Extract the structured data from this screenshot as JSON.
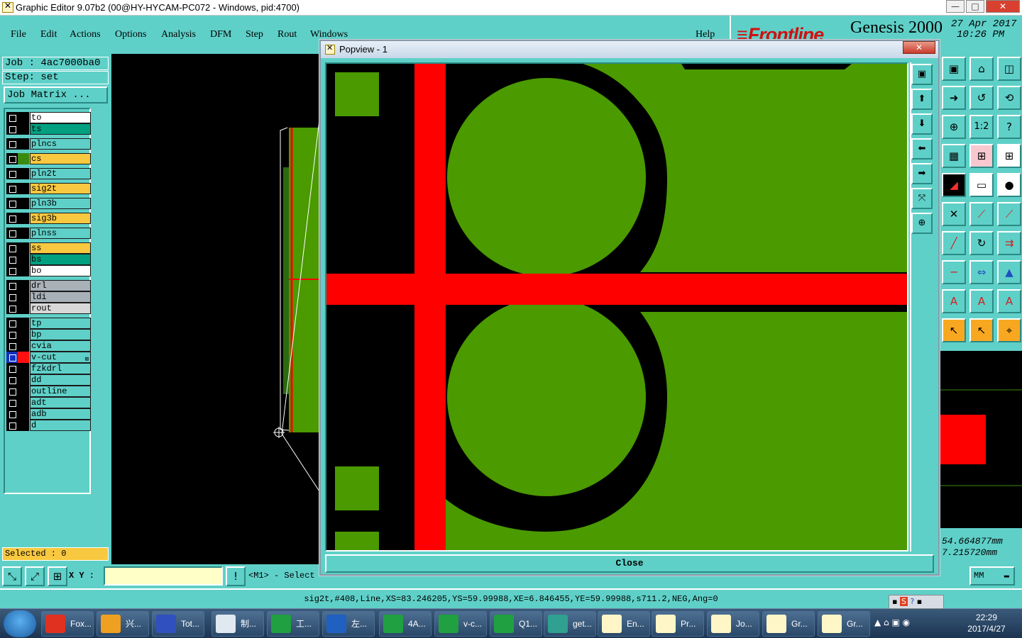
{
  "window": {
    "title": "Graphic Editor 9.07b2 (00@HY-HYCAM-PC072 - Windows, pid:4700)",
    "min_glyph": "—",
    "max_glyph": "□",
    "close_glyph": "✕"
  },
  "menu": {
    "items": [
      "File",
      "Edit",
      "Actions",
      "Options",
      "Analysis",
      "DFM",
      "Step",
      "Rout",
      "Windows"
    ],
    "help": "Help"
  },
  "brand": {
    "logo": "Frontline",
    "product": "Genesis 2000",
    "date": "27 Apr 2017",
    "time": "10:26 PM"
  },
  "job": {
    "job_line": "Job : 4ac7000ba0",
    "step_line": "Step: set",
    "matrix_button": "Job Matrix ..."
  },
  "layers": [
    {
      "name": "to",
      "color": "#ffffff"
    },
    {
      "name": "ts",
      "color": "#00a080"
    },
    {
      "name": "plncs",
      "color": "#5fd0c8"
    },
    {
      "name": "cs",
      "color": "#f8c840",
      "swatch": "#3a8a10"
    },
    {
      "name": "pln2t",
      "color": "#5fd0c8"
    },
    {
      "name": "sig2t",
      "color": "#f8c840"
    },
    {
      "name": "pln3b",
      "color": "#5fd0c8"
    },
    {
      "name": "sig3b",
      "color": "#f8c840"
    },
    {
      "name": "plnss",
      "color": "#5fd0c8"
    },
    {
      "name": "ss",
      "color": "#f8c840"
    },
    {
      "name": "bs",
      "color": "#00a080"
    },
    {
      "name": "bo",
      "color": "#ffffff"
    },
    {
      "name": "drl",
      "color": "#a8b0b8"
    },
    {
      "name": "ldi",
      "color": "#a8b0b8"
    },
    {
      "name": "rout",
      "color": "#d8d8d8"
    },
    {
      "name": "tp",
      "color": "#5fd0c8"
    },
    {
      "name": "bp",
      "color": "#5fd0c8"
    },
    {
      "name": "cvia",
      "color": "#5fd0c8"
    },
    {
      "name": "v-cut",
      "color": "#5fd0c8",
      "swatch": "#ff1010",
      "marker": "⊞",
      "active": true
    },
    {
      "name": "fzkdrl",
      "color": "#5fd0c8"
    },
    {
      "name": "dd",
      "color": "#5fd0c8"
    },
    {
      "name": "outline",
      "color": "#5fd0c8"
    },
    {
      "name": "adt",
      "color": "#5fd0c8"
    },
    {
      "name": "adb",
      "color": "#5fd0c8"
    },
    {
      "name": "d",
      "color": "#5fd0c8"
    }
  ],
  "selected": "Selected : 0",
  "coords": {
    "x": "54.664877mm",
    "y": "7.215720mm"
  },
  "input": {
    "label": "X Y :",
    "value": "",
    "prompt": "<M1> - Select",
    "units": "MM"
  },
  "status": "sig2t,#408,Line,XS=83.246205,YS=59.99988,XE=6.846455,YE=59.99988,s711.2,NEG,Ang=0",
  "popup": {
    "title": "Popview - 1",
    "close_glyph": "✕",
    "close_button": "Close"
  },
  "colors": {
    "copper": "#4a9a00",
    "vcut": "#ff0000",
    "background": "#000000",
    "panel": "#5fd0c8"
  },
  "taskbar": {
    "items": [
      {
        "label": "Fox...",
        "icon": "foxit-icon",
        "color": "#e03020"
      },
      {
        "label": "兴...",
        "icon": "shell-icon",
        "color": "#f0a020"
      },
      {
        "label": "Tot...",
        "icon": "floppy-icon",
        "color": "#3050c0"
      },
      {
        "label": "制...",
        "icon": "notepad-icon",
        "color": "#e0e8f0"
      },
      {
        "label": "工...",
        "icon": "green-p-icon",
        "color": "#20a040"
      },
      {
        "label": "左...",
        "icon": "frontline-icon",
        "color": "#2060c0"
      },
      {
        "label": "4A...",
        "icon": "excel-icon",
        "color": "#20a040"
      },
      {
        "label": "v-c...",
        "icon": "excel-icon",
        "color": "#20a040"
      },
      {
        "label": "Q1...",
        "icon": "excel-icon",
        "color": "#20a040"
      },
      {
        "label": "get...",
        "icon": "eye-icon",
        "color": "#30a090"
      },
      {
        "label": "En...",
        "icon": "genesis-icon",
        "color": "#fff6c8"
      },
      {
        "label": "Pr...",
        "icon": "genesis-icon",
        "color": "#fff6c8"
      },
      {
        "label": "Jo...",
        "icon": "genesis-icon",
        "color": "#fff6c8"
      },
      {
        "label": "Gr...",
        "icon": "genesis-icon",
        "color": "#fff6c8"
      },
      {
        "label": "Gr...",
        "icon": "genesis-icon",
        "color": "#fff6c8"
      }
    ],
    "clock_time": "22:29",
    "clock_date": "2017/4/27"
  }
}
